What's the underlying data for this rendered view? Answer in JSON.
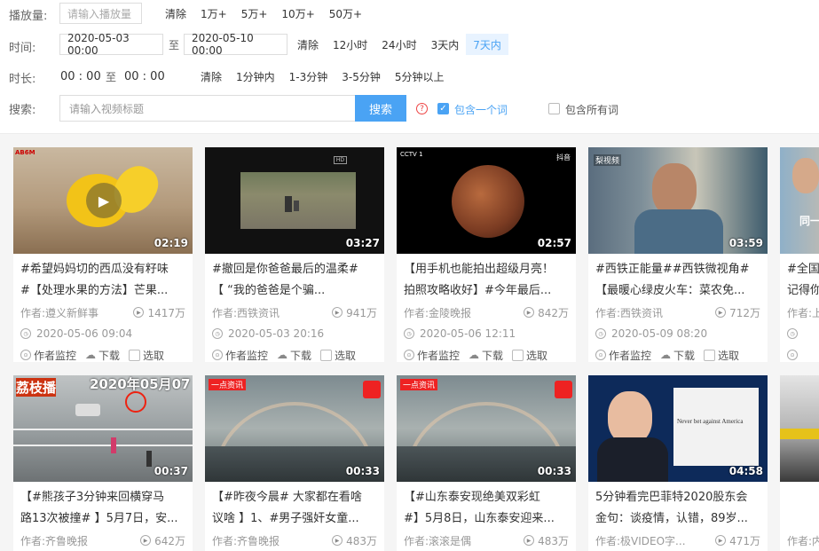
{
  "filters": {
    "plays": {
      "label": "播放量:",
      "placeholder": "请输入播放量",
      "options": [
        "清除",
        "1万+",
        "5万+",
        "10万+",
        "50万+"
      ]
    },
    "time": {
      "label": "时间:",
      "start": "2020-05-03 00:00",
      "to": "至",
      "end": "2020-05-10 00:00",
      "options": [
        "清除",
        "12小时",
        "24小时",
        "3天内",
        "7天内"
      ],
      "active_option": "7天内"
    },
    "duration": {
      "label": "时长:",
      "start": "00 : 00",
      "to": "至",
      "end": "00 : 00",
      "options": [
        "清除",
        "1分钟内",
        "1-3分钟",
        "3-5分钟",
        "5分钟以上"
      ]
    },
    "search": {
      "label": "搜索:",
      "placeholder": "请输入视频标题",
      "button": "搜索",
      "help_icon": "question-icon",
      "contain_one": "包含一个词",
      "contain_all": "包含所有词",
      "contain_one_checked": true,
      "contain_all_checked": false
    }
  },
  "actions": {
    "monitor": "作者监控",
    "download": "下载",
    "select": "选取"
  },
  "cards": [
    {
      "duration": "02:19",
      "title_1": "#希望妈妈切的西瓜没有籽味",
      "title_2": "#【处理水果的方法】芒果...",
      "author": "作者:遵义新鲜事",
      "plays": "1417万",
      "date": "2020-05-06 09:04"
    },
    {
      "duration": "03:27",
      "title_1": "#撤回是你爸爸最后的温柔#",
      "title_2": "【 “我的爸爸是个骗...",
      "author": "作者:西铁资讯",
      "plays": "941万",
      "date": "2020-05-03 20:16"
    },
    {
      "duration": "02:57",
      "title_1": "【用手机也能拍出超级月亮！",
      "title_2": "拍照攻略收好】#今年最后...",
      "author": "作者:金陵晚报",
      "plays": "842万",
      "date": "2020-05-06 12:11"
    },
    {
      "duration": "03:59",
      "title_1": "#西铁正能量##西铁微视角#",
      "title_2": "【最暖心绿皮火车：菜农免...",
      "author": "作者:西铁资讯",
      "plays": "712万",
      "date": "2020-05-09 08:20"
    },
    {
      "duration": "",
      "title_1": "#全国",
      "title_2": "记得你",
      "author": "作者:上",
      "plays": "",
      "date": ""
    },
    {
      "duration": "00:37",
      "title_1": "【#熊孩子3分钟来回横穿马",
      "title_2": "路13次被撞# 】5月7日，安...",
      "author": "作者:齐鲁晚报",
      "plays": "642万",
      "date": ""
    },
    {
      "duration": "00:33",
      "title_1": "【#昨夜今晨# 大家都在看啥",
      "title_2": "议啥 】1、#男子强奸女童...",
      "author": "作者:齐鲁晚报",
      "plays": "483万",
      "date": ""
    },
    {
      "duration": "00:33",
      "title_1": "【#山东泰安现绝美双彩虹",
      "title_2": "#】5月8日，山东泰安迎来...",
      "author": "作者:滚滚是偶",
      "plays": "483万",
      "date": ""
    },
    {
      "duration": "04:58",
      "title_1": "5分钟看完巴菲特2020股东会",
      "title_2": "金句：谈疫情，认错，89岁...",
      "author": "作者:极VIDEO字...",
      "plays": "471万",
      "date": ""
    },
    {
      "duration": "",
      "title_1": "",
      "title_2": "",
      "author": "作者:内",
      "plays": "",
      "date": ""
    }
  ],
  "thumb_texts": {
    "t1_logo": "AB6M",
    "t3_logo": "CCTV 1",
    "t3_wm": "抖音",
    "t4_logo": "梨视频",
    "t5_text": "同一",
    "t6_logo": "荔枝播",
    "t6_date": "2020年05月07",
    "t7_logo": "一点资讯",
    "t8_logo": "一点资讯",
    "t9_text": "Never bet against America"
  }
}
